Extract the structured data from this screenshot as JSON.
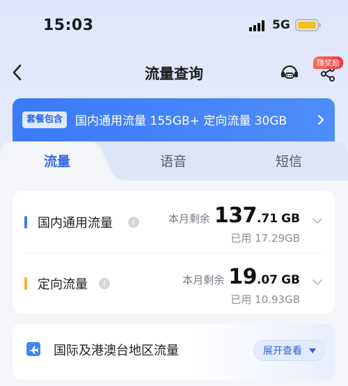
{
  "status_bar": {
    "time": "15:03",
    "network": "5G"
  },
  "nav": {
    "title": "流量查询",
    "earn_badge": "赚奖励"
  },
  "banner": {
    "tag": "套餐包含",
    "text": "国内通用流量 155GB+ 定向流量 30GB"
  },
  "tabs": [
    {
      "label": "流量",
      "active": true
    },
    {
      "label": "语音",
      "active": false
    },
    {
      "label": "短信",
      "active": false
    }
  ],
  "usage": [
    {
      "name": "国内通用流量",
      "color": "#3d7bf5",
      "remain_label": "本月剩余",
      "remain_int": "137",
      "remain_dec": ".71",
      "unit": "GB",
      "used": "已用 17.29GB"
    },
    {
      "name": "定向流量",
      "color": "#f5b335",
      "remain_label": "本月剩余",
      "remain_int": "19",
      "remain_dec": ".07",
      "unit": "GB",
      "used": "已用 10.93GB"
    }
  ],
  "intl": {
    "label": "国际及港澳台地区流量",
    "button": "展开查看"
  },
  "icons": {
    "back": "chevron-left-icon",
    "service": "customer-service-icon",
    "share": "share-icon",
    "info": "info-icon",
    "expand": "chevron-down-icon",
    "plane": "airplane-icon"
  }
}
